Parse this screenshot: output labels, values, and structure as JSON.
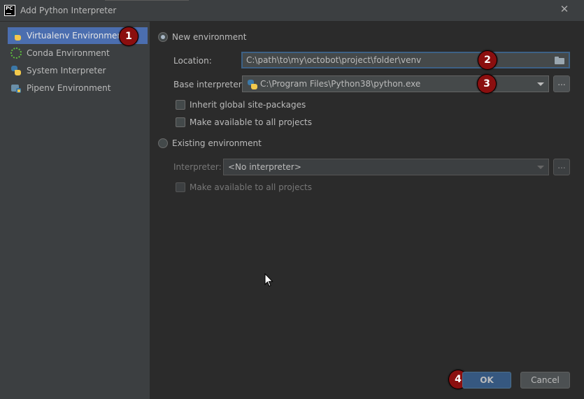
{
  "window": {
    "title": "Add Python Interpreter",
    "app_icon_text": "PC",
    "close_glyph": "✕"
  },
  "sidebar": {
    "items": [
      {
        "label": "Virtualenv Environment",
        "icon": "virtualenv-icon",
        "selected": true
      },
      {
        "label": "Conda Environment",
        "icon": "conda-icon",
        "selected": false
      },
      {
        "label": "System Interpreter",
        "icon": "python-icon",
        "selected": false
      },
      {
        "label": "Pipenv Environment",
        "icon": "pipenv-icon",
        "selected": false
      }
    ]
  },
  "new_env": {
    "radio_label": "New environment",
    "selected": true,
    "location_label": "Location:",
    "location_value": "C:\\path\\to\\my\\octobot\\project\\folder\\venv",
    "base_label": "Base interpreter:",
    "base_value": "C:\\Program Files\\Python38\\python.exe",
    "browse_label": "...",
    "inherit_label": "Inherit global site-packages",
    "make_available_label": "Make available to all projects"
  },
  "existing_env": {
    "radio_label": "Existing environment",
    "selected": false,
    "interpreter_label": "Interpreter:",
    "interpreter_value": "<No interpreter>",
    "browse_label": "...",
    "make_available_label": "Make available to all projects"
  },
  "footer": {
    "ok_label": "OK",
    "cancel_label": "Cancel"
  },
  "annotations": {
    "badge1": "1",
    "badge2": "2",
    "badge3": "3",
    "badge4": "4",
    "badge_color": "#8b0f0f"
  },
  "colors": {
    "selection": "#4b6eaf",
    "focus_border": "#3d6185",
    "primary_button": "#365880"
  }
}
